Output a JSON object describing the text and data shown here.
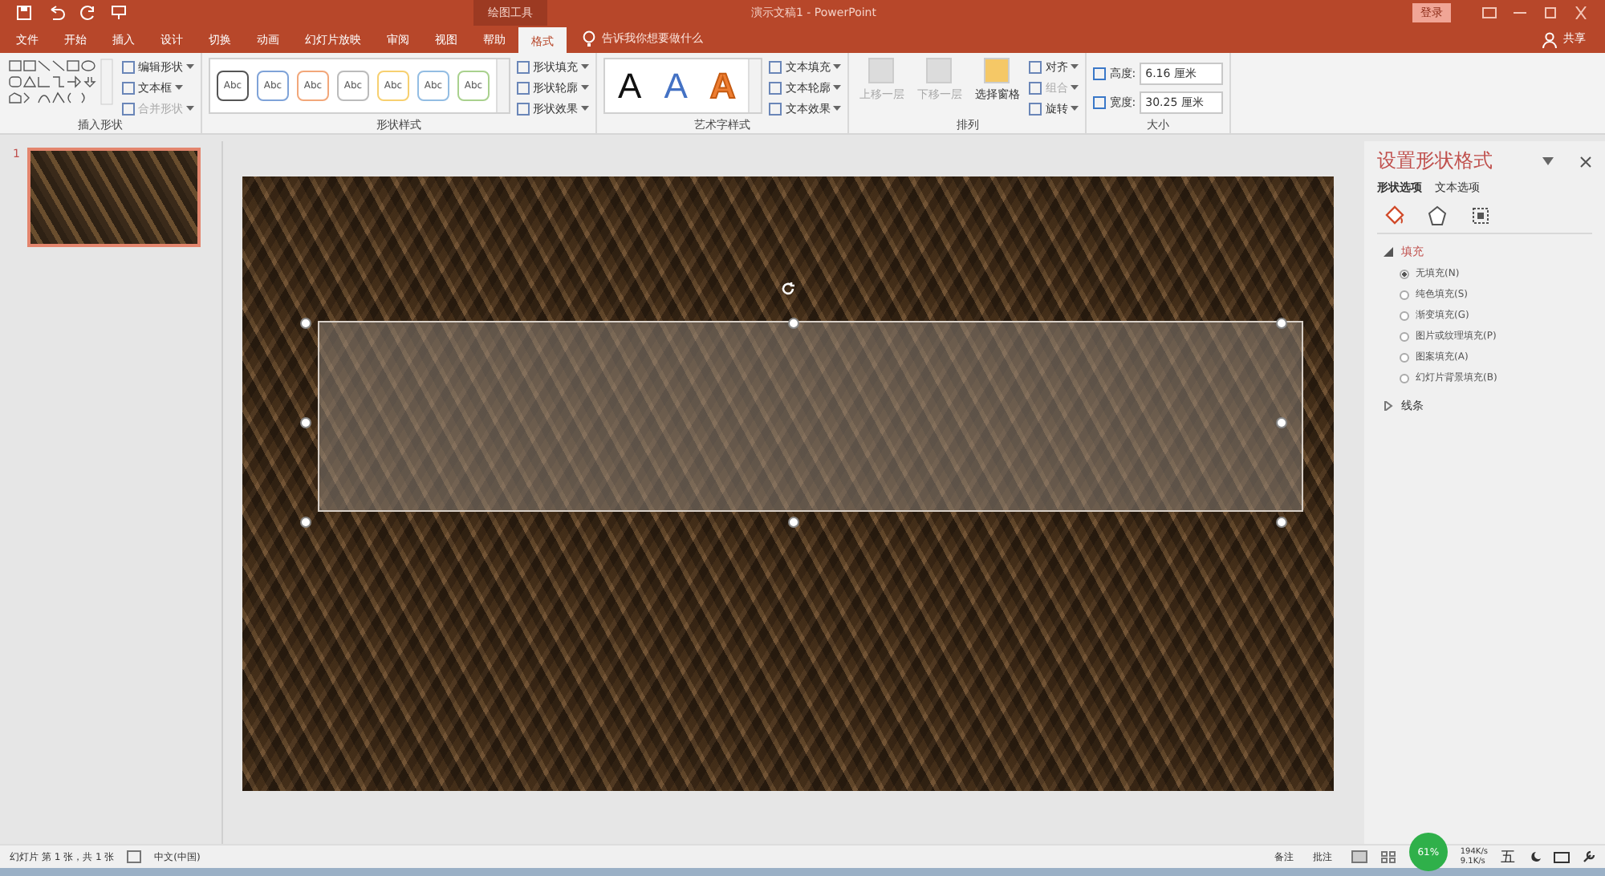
{
  "title_bar": {
    "context_label": "绘图工具",
    "title": "演示文稿1 - PowerPoint",
    "login": "登录"
  },
  "tabs": [
    {
      "label": "文件",
      "selected": false
    },
    {
      "label": "开始",
      "selected": false
    },
    {
      "label": "插入",
      "selected": false
    },
    {
      "label": "设计",
      "selected": false
    },
    {
      "label": "切换",
      "selected": false
    },
    {
      "label": "动画",
      "selected": false
    },
    {
      "label": "幻灯片放映",
      "selected": false
    },
    {
      "label": "审阅",
      "selected": false
    },
    {
      "label": "视图",
      "selected": false
    },
    {
      "label": "帮助",
      "selected": false
    },
    {
      "label": "格式",
      "selected": true
    }
  ],
  "tell_me": "告诉我你想要做什么",
  "share": "共享",
  "insert_shapes": {
    "label": "插入形状",
    "buttons": [
      {
        "label": "编辑形状",
        "disabled": false
      },
      {
        "label": "文本框",
        "disabled": false
      },
      {
        "label": "合并形状",
        "disabled": true
      }
    ]
  },
  "shape_styles": {
    "label": "形状样式",
    "presets": [
      {
        "text": "Abc",
        "color": "#555555"
      },
      {
        "text": "Abc",
        "color": "#7fa3d8"
      },
      {
        "text": "Abc",
        "color": "#f2a77a"
      },
      {
        "text": "Abc",
        "color": "#bbbbbb"
      },
      {
        "text": "Abc",
        "color": "#f7d070"
      },
      {
        "text": "Abc",
        "color": "#93bde3"
      },
      {
        "text": "Abc",
        "color": "#a9d18e"
      }
    ],
    "buttons": [
      "形状填充",
      "形状轮廓",
      "形状效果"
    ]
  },
  "wordart": {
    "label": "艺术字样式",
    "presets": [
      {
        "text": "A",
        "kind": "solid",
        "color": "#111111"
      },
      {
        "text": "A",
        "kind": "solid",
        "color": "#4472c4"
      },
      {
        "text": "A",
        "kind": "outline",
        "color": "#ed7d31"
      }
    ],
    "buttons": [
      "文本填充",
      "文本轮廓",
      "文本效果"
    ]
  },
  "arrange": {
    "label": "排列",
    "large": [
      {
        "label": "上移一层",
        "disabled": true
      },
      {
        "label": "下移一层",
        "disabled": true
      },
      {
        "label": "选择窗格",
        "disabled": false
      }
    ],
    "small": [
      {
        "label": "对齐",
        "disabled": false
      },
      {
        "label": "组合",
        "disabled": true
      },
      {
        "label": "旋转",
        "disabled": false
      }
    ]
  },
  "size": {
    "label": "大小",
    "fields": [
      {
        "label": "高度:",
        "value": "6.16 厘米"
      },
      {
        "label": "宽度:",
        "value": "30.25 厘米"
      }
    ]
  },
  "thumbnails": [
    {
      "number": "1",
      "selected": true
    }
  ],
  "panel": {
    "title": "设置形状格式",
    "tabs": [
      {
        "label": "形状选项",
        "selected": true
      },
      {
        "label": "文本选项",
        "selected": false
      }
    ],
    "sections": [
      {
        "label": "填充",
        "expanded": true,
        "options": [
          {
            "label": "无填充(N)",
            "selected": true
          },
          {
            "label": "纯色填充(S)",
            "selected": false
          },
          {
            "label": "渐变填充(G)",
            "selected": false
          },
          {
            "label": "图片或纹理填充(P)",
            "selected": false
          },
          {
            "label": "图案填充(A)",
            "selected": false
          },
          {
            "label": "幻灯片背景填充(B)",
            "selected": false
          }
        ]
      },
      {
        "label": "线条",
        "expanded": false
      }
    ]
  },
  "status_bar": {
    "slide_info": "幻灯片 第 1 张，共 1 张",
    "language": "中文(中国)",
    "notes": "备注",
    "comments": "批注"
  },
  "tray": {
    "percent": "61%",
    "up": "194K/s",
    "down": "9.1K/s",
    "ime": "五"
  }
}
